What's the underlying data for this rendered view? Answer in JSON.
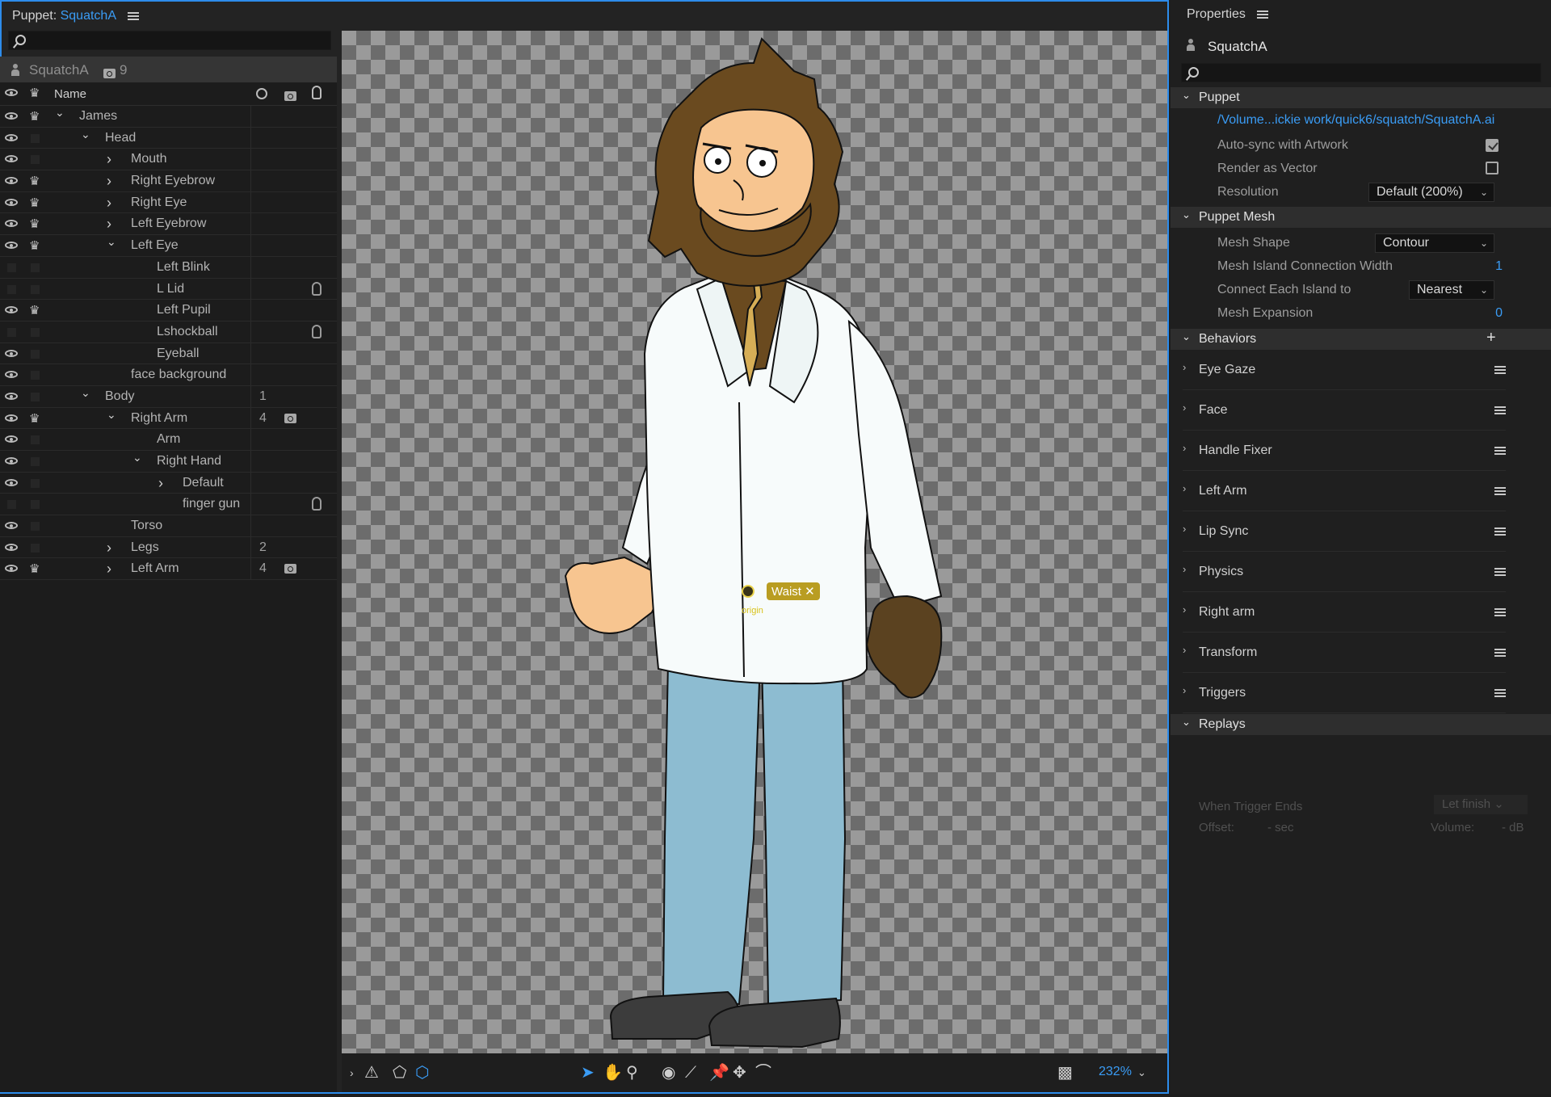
{
  "puppet_panel": {
    "title_prefix": "Puppet: ",
    "title_name": "SquatchA",
    "puppet_name": "SquatchA",
    "puppet_count": "9",
    "col_name": "Name",
    "layers": [
      {
        "label": "James",
        "vis": true,
        "crown": true,
        "twisty": "open",
        "indent": 0,
        "count": "",
        "cam": false,
        "hand": false
      },
      {
        "label": "Head",
        "vis": true,
        "crown": false,
        "twisty": "open",
        "indent": 1,
        "count": "",
        "cam": false,
        "hand": false
      },
      {
        "label": "Mouth",
        "vis": true,
        "crown": false,
        "twisty": "closed",
        "indent": 2,
        "count": "",
        "cam": false,
        "hand": false
      },
      {
        "label": "Right Eyebrow",
        "vis": true,
        "crown": true,
        "twisty": "closed",
        "indent": 2,
        "count": "",
        "cam": false,
        "hand": false
      },
      {
        "label": "Right Eye",
        "vis": true,
        "crown": true,
        "twisty": "closed",
        "indent": 2,
        "count": "",
        "cam": false,
        "hand": false
      },
      {
        "label": "Left Eyebrow",
        "vis": true,
        "crown": true,
        "twisty": "closed",
        "indent": 2,
        "count": "",
        "cam": false,
        "hand": false
      },
      {
        "label": "Left Eye",
        "vis": true,
        "crown": true,
        "twisty": "open",
        "indent": 2,
        "count": "",
        "cam": false,
        "hand": false
      },
      {
        "label": "Left Blink",
        "vis": false,
        "crown": false,
        "twisty": "",
        "indent": 3,
        "count": "",
        "cam": false,
        "hand": false
      },
      {
        "label": "L Lid",
        "vis": false,
        "crown": false,
        "twisty": "",
        "indent": 3,
        "count": "",
        "cam": false,
        "hand": true
      },
      {
        "label": "Left Pupil",
        "vis": true,
        "crown": true,
        "twisty": "",
        "indent": 3,
        "count": "",
        "cam": false,
        "hand": false
      },
      {
        "label": "Lshockball",
        "vis": false,
        "crown": false,
        "twisty": "",
        "indent": 3,
        "count": "",
        "cam": false,
        "hand": true
      },
      {
        "label": "Eyeball",
        "vis": true,
        "crown": false,
        "twisty": "",
        "indent": 3,
        "count": "",
        "cam": false,
        "hand": false
      },
      {
        "label": "face background",
        "vis": true,
        "crown": false,
        "twisty": "",
        "indent": 2,
        "count": "",
        "cam": false,
        "hand": false
      },
      {
        "label": "Body",
        "vis": true,
        "crown": false,
        "twisty": "open",
        "indent": 1,
        "count": "1",
        "cam": false,
        "hand": false
      },
      {
        "label": "Right Arm",
        "vis": true,
        "crown": true,
        "twisty": "open",
        "indent": 2,
        "count": "4",
        "cam": true,
        "hand": false
      },
      {
        "label": "Arm",
        "vis": true,
        "crown": false,
        "twisty": "",
        "indent": 3,
        "count": "",
        "cam": false,
        "hand": false
      },
      {
        "label": "Right Hand",
        "vis": true,
        "crown": false,
        "twisty": "open",
        "indent": 3,
        "count": "",
        "cam": false,
        "hand": false
      },
      {
        "label": "Default",
        "vis": true,
        "crown": false,
        "twisty": "closed",
        "indent": 4,
        "count": "",
        "cam": false,
        "hand": false
      },
      {
        "label": "finger gun",
        "vis": false,
        "crown": false,
        "twisty": "",
        "indent": 4,
        "count": "",
        "cam": false,
        "hand": true
      },
      {
        "label": "Torso",
        "vis": true,
        "crown": false,
        "twisty": "",
        "indent": 2,
        "count": "",
        "cam": false,
        "hand": false
      },
      {
        "label": "Legs",
        "vis": true,
        "crown": false,
        "twisty": "closed",
        "indent": 2,
        "count": "2",
        "cam": false,
        "hand": false
      },
      {
        "label": "Left Arm",
        "vis": true,
        "crown": true,
        "twisty": "closed",
        "indent": 2,
        "count": "4",
        "cam": true,
        "hand": false
      }
    ]
  },
  "canvas": {
    "tag_label": "Waist",
    "origin_label": "origin",
    "zoom": "232%"
  },
  "properties": {
    "title": "Properties",
    "puppet_name": "SquatchA",
    "sections": {
      "puppet": "Puppet",
      "puppet_mesh": "Puppet Mesh",
      "behaviors": "Behaviors",
      "replays": "Replays"
    },
    "puppet": {
      "path": "/Volume...ickie work/quick6/squatch/SquatchA.ai",
      "auto_sync_label": "Auto-sync with Artwork",
      "auto_sync": true,
      "render_vector_label": "Render as Vector",
      "render_vector": false,
      "resolution_label": "Resolution",
      "resolution_value": "Default (200%)"
    },
    "mesh": {
      "shape_label": "Mesh Shape",
      "shape_value": "Contour",
      "island_width_label": "Mesh Island Connection Width",
      "island_width_value": "1",
      "connect_label": "Connect Each Island to",
      "connect_value": "Nearest",
      "expansion_label": "Mesh Expansion",
      "expansion_value": "0"
    },
    "behaviors": [
      "Eye Gaze",
      "Face",
      "Handle Fixer",
      "Left Arm",
      "Lip Sync",
      "Physics",
      "Right arm",
      "Transform",
      "Triggers"
    ],
    "replays": {
      "when_label": "When Trigger Ends",
      "when_value": "Let finish",
      "offset_label": "Offset:",
      "offset_value": "- sec",
      "volume_label": "Volume:",
      "volume_value": "- dB"
    }
  }
}
